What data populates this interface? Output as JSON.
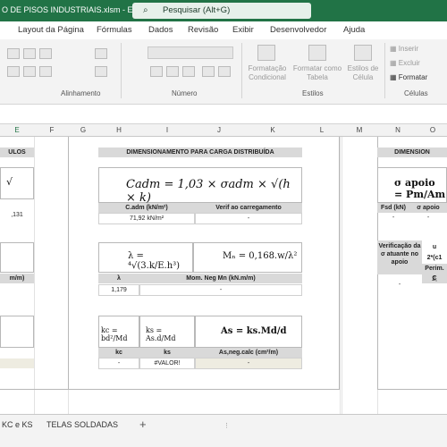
{
  "title": "O DE PISOS INDUSTRIAIS.xlsm  -  Excel",
  "search_placeholder": "Pesquisar (Alt+G)",
  "ribbon_tabs": [
    "Layout da Página",
    "Fórmulas",
    "Dados",
    "Revisão",
    "Exibir",
    "Desenvolvedor",
    "Ajuda"
  ],
  "ribbon_groups": {
    "alignment": "Alinhamento",
    "number": "Número",
    "styles": "Estilos",
    "cells": "Células"
  },
  "ribbon_buttons": {
    "conditional": "Formatação\nCondicional",
    "table": "Formatar como\nTabela",
    "cellstyles": "Estilos de\nCélula",
    "insert": "Inserir",
    "delete": "Excluir",
    "format": "Formatar"
  },
  "columns": [
    "E",
    "F",
    "G",
    "H",
    "I",
    "J",
    "K",
    "L",
    "M",
    "N",
    "O"
  ],
  "left_header": "ULOS",
  "left_val1": ",131",
  "left_val2": "m/m)",
  "sheet_tabs": [
    "KC e KS",
    "TELAS SOLDADAS"
  ],
  "add_sheet": "+",
  "main": {
    "title": "DIMENSIONAMENTO PARA CARGA DISTRIBUÍDA",
    "formula1": "Cadm = 1,03 × σadm × √(h × k)",
    "h1a": "C.adm (kN/m²)",
    "h1b": "Verif ao carregamento",
    "v1a": "71,92 kN/m²",
    "v1b": "-",
    "h2a": "λ",
    "h2b": "Mom. Neg Mn (kN.m/m)",
    "v2a": "1,179",
    "v2b": "-",
    "h3a": "kc",
    "h3b": "ks",
    "h3c": "As,neg.calc (cm²/m)",
    "v3a": "-",
    "v3b": "#VALOR!",
    "v3c": "-"
  },
  "right": {
    "title": "DIMENSION",
    "h1a": "Fsd (kN)",
    "h1b": "σ apoio",
    "v1a": "-",
    "v1b": "-",
    "verif": "Verificação da σ atuante no apoio",
    "verif2": "u",
    "verif3": "2*(c1",
    "verif4": "Perim. C",
    "verif5": "2,",
    "v2a": "-"
  }
}
